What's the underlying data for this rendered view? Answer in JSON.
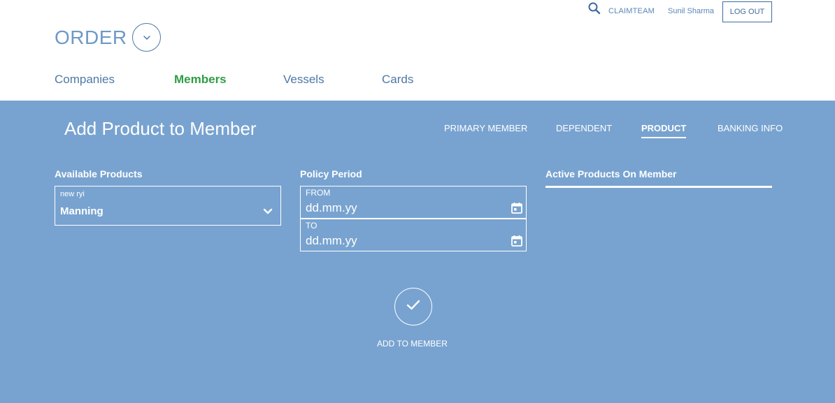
{
  "header": {
    "team": "CLAIMTEAM",
    "user": "Sunil Sharma",
    "logout_label": "LOG OUT",
    "app_title": "ORDER",
    "search_icon": "search-icon",
    "toggle_icon": "chevron-down-icon"
  },
  "nav": {
    "items": [
      {
        "label": "Companies"
      },
      {
        "label": "Members",
        "active": true
      },
      {
        "label": "Vessels"
      },
      {
        "label": "Cards"
      }
    ]
  },
  "panel": {
    "title": "Add Product to Member",
    "tabs": [
      {
        "label": "PRIMARY MEMBER"
      },
      {
        "label": "DEPENDENT"
      },
      {
        "label": "PRODUCT",
        "active": true
      },
      {
        "label": "BANKING INFO"
      }
    ],
    "available_products": {
      "label": "Available Products",
      "small_text": "new ryi",
      "selected": "Manning"
    },
    "policy_period": {
      "label": "Policy Period",
      "from_label": "FROM",
      "from_value": "dd.mm.yy",
      "to_label": "TO",
      "to_value": "dd.mm.yy"
    },
    "active_products": {
      "label": "Active Products On Member"
    },
    "add_button_label": "ADD TO MEMBER"
  },
  "colors": {
    "panel_bg": "#78a3d0",
    "nav_active": "#2e9e45",
    "nav_text": "#4f78a6",
    "order_title": "#6f98c8"
  }
}
